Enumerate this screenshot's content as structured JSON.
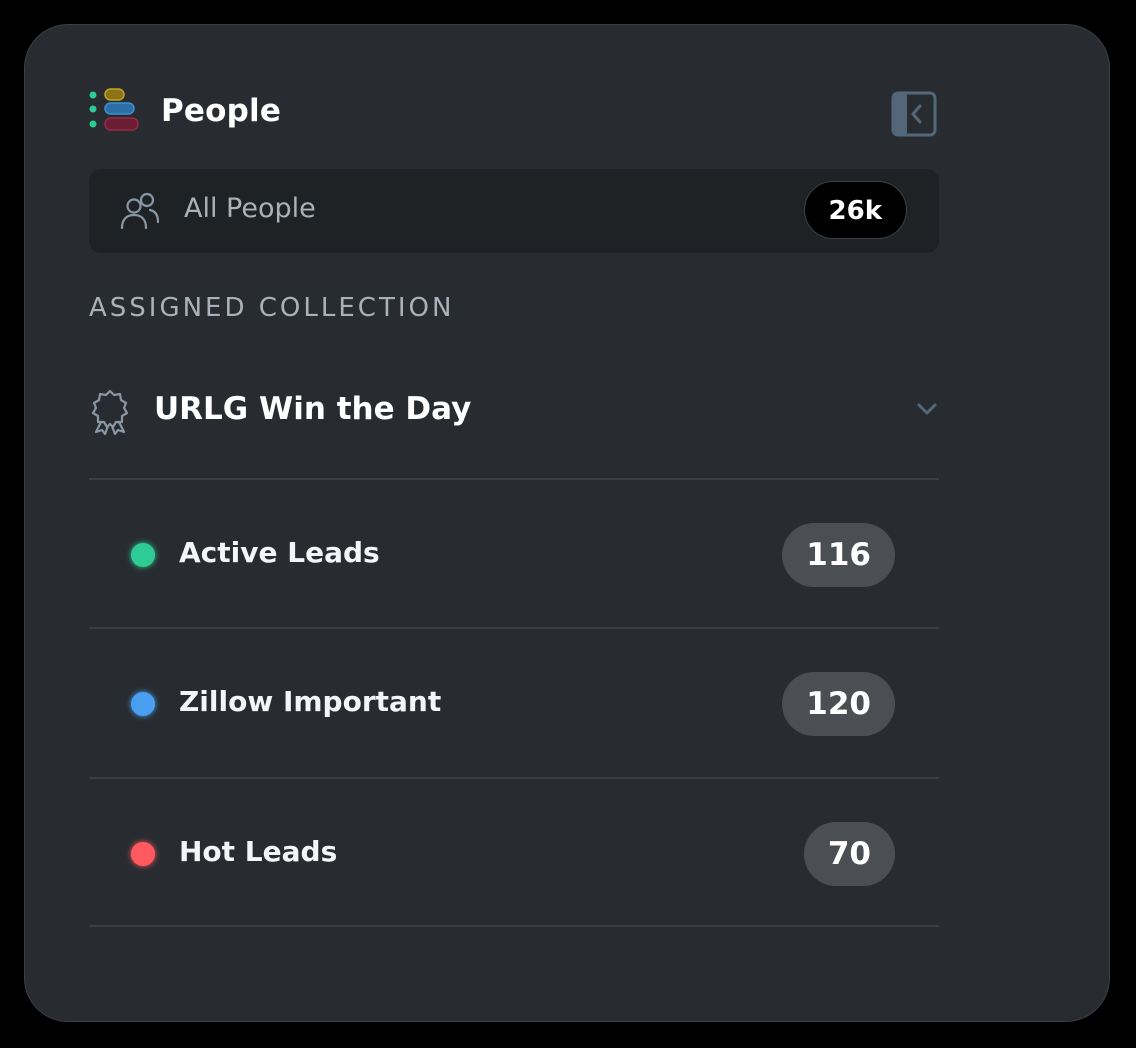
{
  "header": {
    "title": "People",
    "icon": "stacked-list-icon",
    "collapse_icon": "sidebar-collapse-icon"
  },
  "all_people": {
    "label": "All People",
    "count": "26k",
    "icon": "people-icon"
  },
  "section": {
    "heading": "ASSIGNED COLLECTION"
  },
  "collection": {
    "title": "URLG Win the Day",
    "icon": "ribbon-icon",
    "expand_icon": "chevron-down-icon"
  },
  "lists": [
    {
      "label": "Active Leads",
      "count": "116",
      "color": "#2ecc94"
    },
    {
      "label": "Zillow Important",
      "count": "120",
      "color": "#4a9ff0"
    },
    {
      "label": "Hot Leads",
      "count": "70",
      "color": "#ff5a5f"
    }
  ],
  "colors": {
    "background": "#000000",
    "panel": "#282c31",
    "card": "#1f2225",
    "muted_text": "#a9b2ba",
    "badge": "#4b4f54"
  }
}
